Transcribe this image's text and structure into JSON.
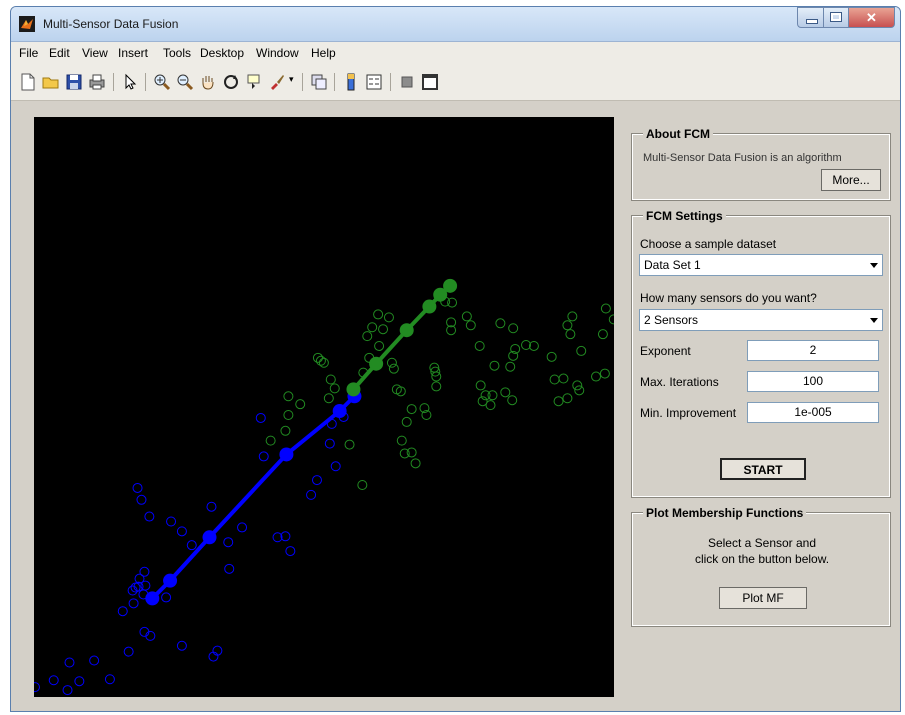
{
  "window": {
    "title": "Multi-Sensor Data Fusion"
  },
  "menu": [
    "File",
    "Edit",
    "View",
    "Insert",
    "Tools",
    "Desktop",
    "Window",
    "Help"
  ],
  "toolbar": [
    "new-icon",
    "open-icon",
    "save-icon",
    "print-icon",
    "pointer-icon",
    "zoom-in-icon",
    "zoom-out-icon",
    "pan-icon",
    "rotate-icon",
    "data-cursor-icon",
    "brush-icon",
    "link-icon",
    "colorbar-icon",
    "legend-icon",
    "hide-tools-icon",
    "show-tools-icon"
  ],
  "about": {
    "title": "About FCM",
    "text": "Multi-Sensor Data Fusion is an algorithm",
    "more_label": "More..."
  },
  "settings": {
    "title": "FCM Settings",
    "dataset_label": "Choose a sample dataset",
    "dataset_value": "Data Set 1",
    "sensors_label": "How many sensors do you want?",
    "sensors_value": "2 Sensors",
    "exponent_label": "Exponent",
    "exponent_value": "2",
    "maxiter_label": "Max. Iterations",
    "maxiter_value": "100",
    "minimp_label": "Min. Improvement",
    "minimp_value": "1e-005",
    "start_label": "START"
  },
  "plot_mf": {
    "title": "Plot Membership Functions",
    "line1": "Select a Sensor and",
    "line2": "click on the button below.",
    "button_label": "Plot MF"
  },
  "colors": {
    "blue_cluster": "#0000ff",
    "green_cluster": "#228b22",
    "axes_bg": "#000000"
  },
  "chart_data": {
    "type": "scatter",
    "series": [
      {
        "color": "#0000ff",
        "points": [
          [
            1,
            10
          ],
          [
            20,
            17
          ],
          [
            34,
            7
          ],
          [
            46,
            16
          ],
          [
            36,
            35
          ],
          [
            61,
            37
          ],
          [
            77,
            18
          ],
          [
            96,
            46
          ],
          [
            112,
            66
          ],
          [
            90,
            87
          ],
          [
            101,
            95
          ],
          [
            100,
            108
          ],
          [
            103,
            111
          ],
          [
            106,
            112
          ],
          [
            111,
            104
          ],
          [
            113,
            113
          ],
          [
            107,
            120
          ],
          [
            112,
            127
          ],
          [
            117,
            183
          ],
          [
            109,
            200
          ],
          [
            105,
            212
          ],
          [
            139,
            178
          ],
          [
            150,
            168
          ],
          [
            160,
            154
          ],
          [
            180,
            193
          ],
          [
            197,
            157
          ],
          [
            198,
            130
          ],
          [
            211,
            172
          ],
          [
            230,
            283
          ],
          [
            233,
            244
          ],
          [
            247,
            162
          ],
          [
            255,
            163
          ],
          [
            260,
            148
          ],
          [
            281,
            205
          ],
          [
            287,
            220
          ],
          [
            300,
            257
          ],
          [
            302,
            277
          ],
          [
            306,
            234
          ],
          [
            314,
            284
          ],
          [
            150,
            52
          ],
          [
            182,
            41
          ],
          [
            186,
            47
          ],
          [
            118,
            62
          ],
          [
            134,
            101
          ]
        ],
        "line": [
          [
            120,
            100
          ],
          [
            138,
            118
          ],
          [
            178,
            162
          ],
          [
            256,
            246
          ],
          [
            310,
            290
          ],
          [
            325,
            305
          ]
        ]
      },
      {
        "color": "#228b22",
        "points": [
          [
            255,
            270
          ],
          [
            240,
            260
          ],
          [
            258,
            286
          ],
          [
            258,
            305
          ],
          [
            270,
            297
          ],
          [
            288,
            344
          ],
          [
            291,
            341
          ],
          [
            294,
            339
          ],
          [
            299,
            303
          ],
          [
            301,
            322
          ],
          [
            305,
            313
          ],
          [
            320,
            256
          ],
          [
            333,
            215
          ],
          [
            334,
            329
          ],
          [
            338,
            366
          ],
          [
            340,
            344
          ],
          [
            343,
            375
          ],
          [
            349,
            388
          ],
          [
            350,
            356
          ],
          [
            354,
            373
          ],
          [
            360,
            385
          ],
          [
            363,
            339
          ],
          [
            365,
            333
          ],
          [
            368,
            312
          ],
          [
            372,
            310
          ],
          [
            373,
            260
          ],
          [
            376,
            247
          ],
          [
            378,
            279
          ],
          [
            383,
            292
          ],
          [
            383,
            248
          ],
          [
            387,
            237
          ],
          [
            396,
            293
          ],
          [
            398,
            286
          ],
          [
            406,
            334
          ],
          [
            407,
            330
          ],
          [
            408,
            325
          ],
          [
            408,
            315
          ],
          [
            417,
            401
          ],
          [
            423,
            372
          ],
          [
            423,
            380
          ],
          [
            424,
            400
          ],
          [
            439,
            386
          ],
          [
            443,
            377
          ],
          [
            452,
            356
          ],
          [
            453,
            316
          ],
          [
            455,
            300
          ],
          [
            458,
            306
          ],
          [
            463,
            296
          ],
          [
            465,
            306
          ],
          [
            467,
            336
          ],
          [
            473,
            379
          ],
          [
            478,
            309
          ],
          [
            483,
            335
          ],
          [
            486,
            346
          ],
          [
            486,
            374
          ],
          [
            485,
            301
          ],
          [
            488,
            353
          ],
          [
            499,
            357
          ],
          [
            507,
            356
          ],
          [
            525,
            345
          ],
          [
            528,
            322
          ],
          [
            532,
            300
          ],
          [
            537,
            323
          ],
          [
            541,
            377
          ],
          [
            546,
            386
          ],
          [
            541,
            303
          ],
          [
            544,
            368
          ],
          [
            551,
            316
          ],
          [
            553,
            311
          ],
          [
            555,
            351
          ],
          [
            570,
            325
          ],
          [
            577,
            368
          ],
          [
            579,
            328
          ],
          [
            580,
            394
          ],
          [
            588,
            383
          ],
          [
            595,
            326
          ],
          [
            600,
            348
          ],
          [
            610,
            327
          ],
          [
            612,
            330
          ],
          [
            614,
            313
          ],
          [
            627,
            352
          ],
          [
            617,
            381
          ],
          [
            633,
            345
          ],
          [
            638,
            367
          ],
          [
            638,
            419
          ],
          [
            644,
            412
          ],
          [
            651,
            387
          ],
          [
            660,
            424
          ],
          [
            660,
            395
          ],
          [
            668,
            384
          ],
          [
            687,
            428
          ],
          [
            692,
            428
          ],
          [
            700,
            436
          ],
          [
            706,
            433
          ],
          [
            712,
            445
          ],
          [
            724,
            463
          ],
          [
            718,
            469
          ],
          [
            732,
            453
          ],
          [
            746,
            458
          ],
          [
            760,
            460
          ],
          [
            770,
            471
          ],
          [
            790,
            479
          ],
          [
            807,
            471
          ],
          [
            828,
            457
          ]
        ],
        "line": [
          [
            324,
            312
          ],
          [
            347,
            338
          ],
          [
            378,
            372
          ],
          [
            401,
            396
          ],
          [
            412,
            408
          ],
          [
            422,
            417
          ]
        ]
      }
    ]
  }
}
